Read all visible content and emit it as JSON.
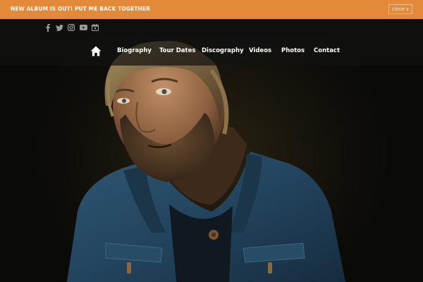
{
  "announcement": {
    "text": "NEW ALBUM IS OUT! PUT ME BACK TOGETHER",
    "close_label": "close x",
    "background": "#e2893a"
  },
  "social": [
    {
      "icon": "facebook-icon"
    },
    {
      "icon": "twitter-icon"
    },
    {
      "icon": "instagram-icon"
    },
    {
      "icon": "youtube-icon"
    },
    {
      "icon": "calendar-icon"
    }
  ],
  "nav": {
    "home_icon": "home-icon",
    "items": [
      {
        "label": "Biography"
      },
      {
        "label": "Tour Dates"
      },
      {
        "label": "Discography"
      },
      {
        "label": "Videos"
      },
      {
        "label": "Photos"
      },
      {
        "label": "Contact"
      }
    ]
  },
  "hero": {
    "image": "portrait-photo"
  }
}
